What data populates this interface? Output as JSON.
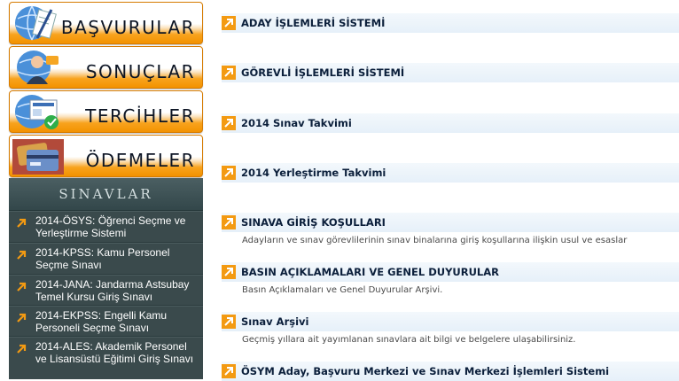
{
  "nav_buttons": [
    {
      "label": "BAŞVURULAR",
      "icon": "application-form-icon"
    },
    {
      "label": "SONUÇLAR",
      "icon": "user-results-icon"
    },
    {
      "label": "TERCİHLER",
      "icon": "preferences-check-icon"
    },
    {
      "label": "ÖDEMELER",
      "icon": "payment-cards-icon"
    }
  ],
  "exams": {
    "heading": "SINAVLAR",
    "items": [
      {
        "label": "2014-ÖSYS: Öğrenci Seçme ve Yerleştirme Sistemi"
      },
      {
        "label": "2014-KPSS: Kamu Personel Seçme Sınavı"
      },
      {
        "label": "2014-JANA: Jandarma Astsubay Temel Kursu Giriş Sınavı"
      },
      {
        "label": "2014-EKPSS: Engelli Kamu Personeli Seçme Sınavı"
      },
      {
        "label": "2014-ALES: Akademik Personel ve Lisansüstü Eğitimi Giriş Sınavı"
      }
    ]
  },
  "links": [
    {
      "title": "ADAY İŞLEMLERİ SİSTEMİ",
      "desc": ""
    },
    {
      "title": "GÖREVLİ İŞLEMLERİ SİSTEMİ",
      "desc": ""
    },
    {
      "title": "2014 Sınav Takvimi",
      "desc": ""
    },
    {
      "title": "2014 Yerleştirme Takvimi",
      "desc": ""
    },
    {
      "title": "SINAVA GİRİŞ KOŞULLARI",
      "desc": "Adayların ve sınav görevlilerinin sınav binalarına giriş koşullarına ilişkin usul ve esaslar"
    },
    {
      "title": "BASIN AÇIKLAMALARI VE GENEL DUYURULAR",
      "desc": "Basın Açıklamaları ve Genel Duyurular Arşivi."
    },
    {
      "title": "Sınav Arşivi",
      "desc": "Geçmiş yıllara ait yayımlanan sınavlara ait bilgi ve belgelere ulaşabilirsiniz."
    },
    {
      "title": "ÖSYM Aday, Başvuru Merkezi ve Sınav Merkezi İşlemleri Sistemi",
      "desc": ""
    }
  ],
  "colors": {
    "accent_orange": "#f39200",
    "panel_dark": "#3a4a4c",
    "link_text": "#0b1f3b"
  }
}
